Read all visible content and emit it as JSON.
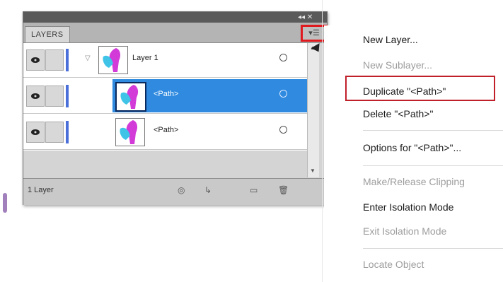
{
  "panel": {
    "tab_label": "LAYERS",
    "title_controls": "◂◂ ✕",
    "menu_button_glyph": "▾☰",
    "status_text": "1 Layer",
    "scroll_up": "▲",
    "scroll_down": "▼"
  },
  "layers": [
    {
      "name": "Layer 1",
      "selected": false,
      "indent": 0,
      "has_twisty": true
    },
    {
      "name": "<Path>",
      "selected": true,
      "indent": 1,
      "has_twisty": false
    },
    {
      "name": "<Path>",
      "selected": false,
      "indent": 1,
      "has_twisty": false
    }
  ],
  "status_icons": [
    "make-clipping-mask-icon",
    "create-sublayer-icon",
    "new-layer-icon",
    "trash-icon"
  ],
  "menu": {
    "items": [
      {
        "label": "New Layer...",
        "enabled": true
      },
      {
        "label": "New Sublayer...",
        "enabled": false
      },
      {
        "label": "Duplicate \"<Path>\"",
        "enabled": true,
        "highlighted": true
      },
      {
        "label": "Delete \"<Path>\"",
        "enabled": true
      },
      {
        "label": "Options for \"<Path>\"...",
        "enabled": true
      },
      {
        "label": "Make/Release Clipping",
        "enabled": false
      },
      {
        "label": "Enter Isolation Mode",
        "enabled": true
      },
      {
        "label": "Exit Isolation Mode",
        "enabled": false
      },
      {
        "label": "Locate Object",
        "enabled": false
      }
    ]
  },
  "colors": {
    "selection": "#2f8ae0",
    "highlight_border": "#e0191f",
    "layer_color": "#4a6fd8"
  }
}
